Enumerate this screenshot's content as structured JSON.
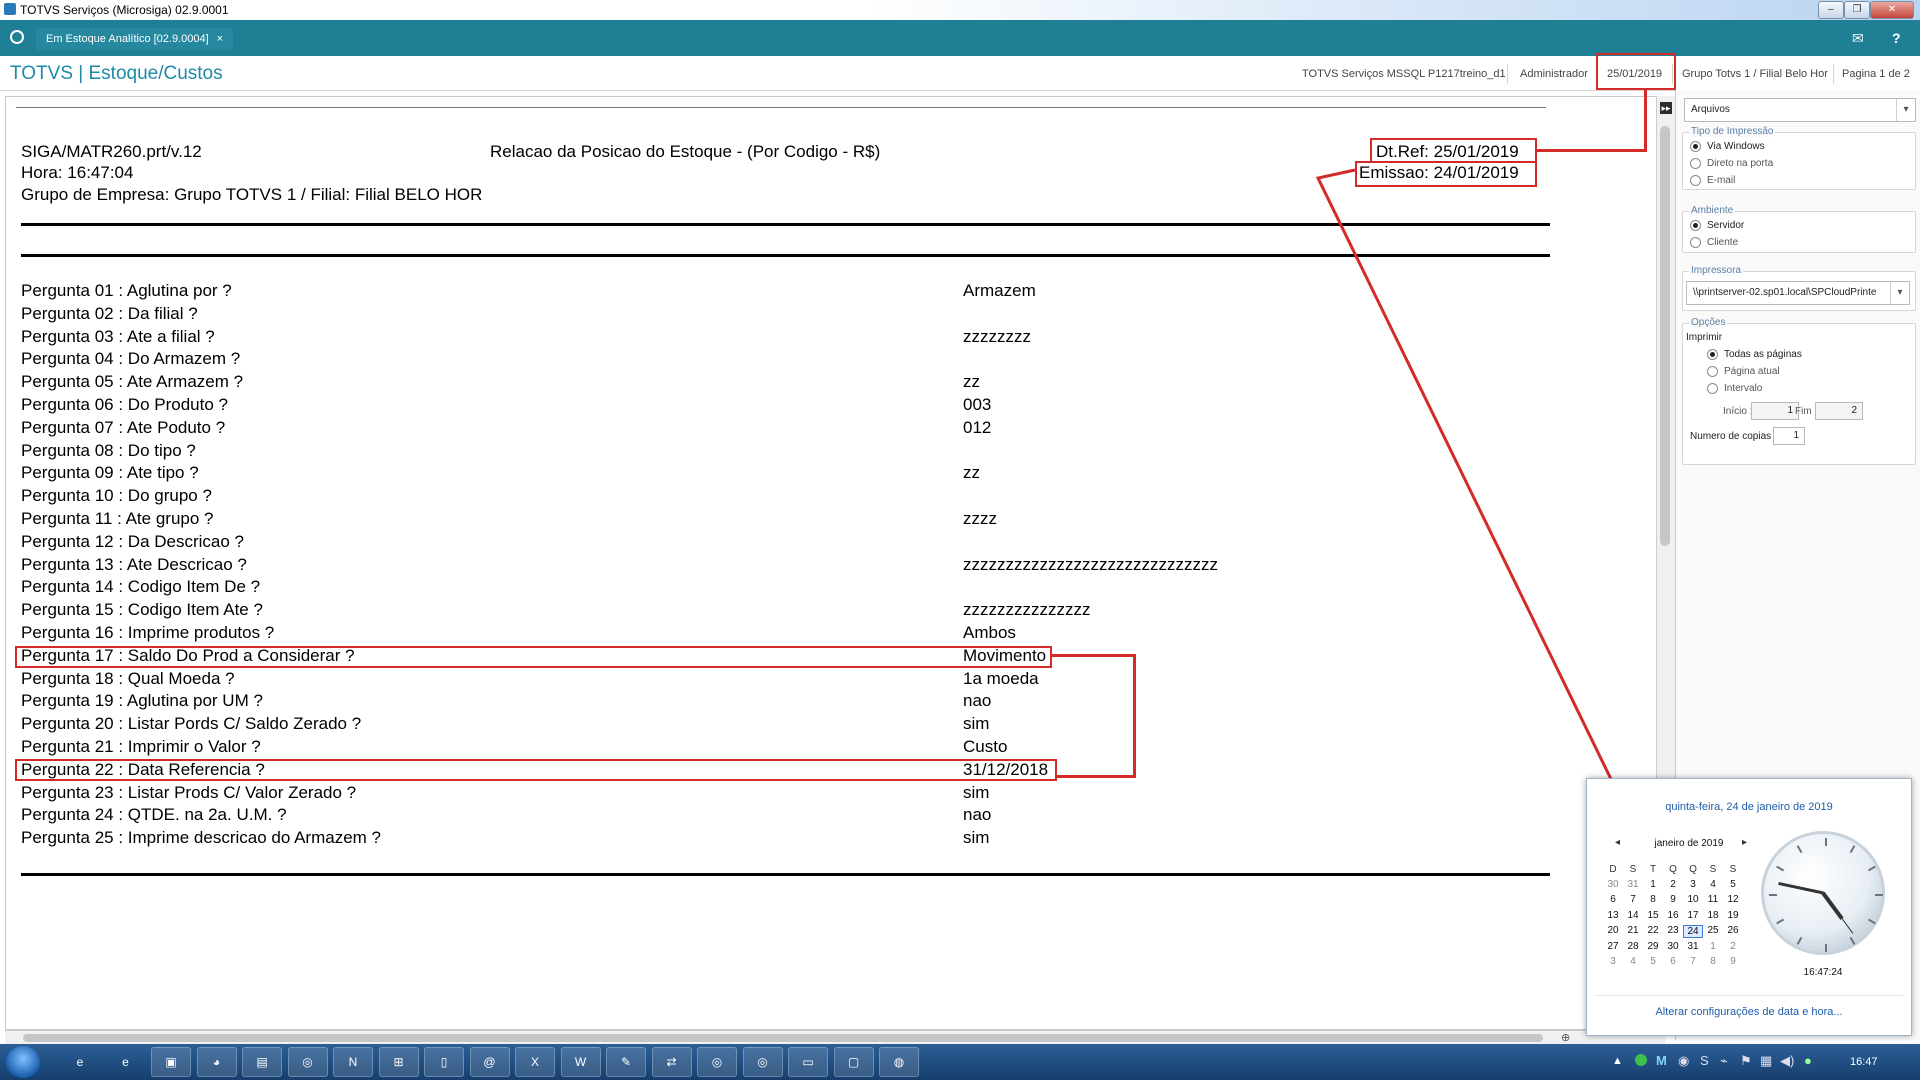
{
  "window": {
    "title": "TOTVS Serviços (Microsiga) 02.9.0001"
  },
  "tabs": [
    {
      "label": "Em Estoque Analítico [02.9.0004]",
      "close": "×"
    }
  ],
  "header": {
    "brand": "TOTVS | Estoque/Custos",
    "environment": "TOTVS Serviços MSSQL P1217treino_d1",
    "user": "Administrador",
    "date": "25/01/2019",
    "company": "Grupo Totvs 1 / Filial Belo Hor",
    "page": "Pagina 1 de 2"
  },
  "report": {
    "program": "SIGA/MATR260.prt/v.12",
    "title": "Relacao da Posicao do Estoque - (Por Codigo - R$)",
    "dt_ref": "Dt.Ref: 25/01/2019",
    "hora": "Hora: 16:47:04",
    "emissao": "Emissao: 24/01/2019",
    "grupo": "Grupo de Empresa: Grupo TOTVS 1 / Filial: Filial BELO HOR",
    "questions": [
      {
        "label": "Pergunta 01 : Aglutina por ?",
        "value": "Armazem"
      },
      {
        "label": "Pergunta 02 : Da filial ?",
        "value": ""
      },
      {
        "label": "Pergunta 03 : Ate a filial ?",
        "value": "zzzzzzzz"
      },
      {
        "label": "Pergunta 04 : Do Armazem ?",
        "value": ""
      },
      {
        "label": "Pergunta 05 : Ate Armazem ?",
        "value": "zz"
      },
      {
        "label": "Pergunta 06 : Do Produto ?",
        "value": "003"
      },
      {
        "label": "Pergunta 07 : Ate Poduto ?",
        "value": "012"
      },
      {
        "label": "Pergunta 08 : Do tipo ?",
        "value": ""
      },
      {
        "label": "Pergunta 09 : Ate tipo ?",
        "value": "zz"
      },
      {
        "label": "Pergunta 10 : Do grupo ?",
        "value": ""
      },
      {
        "label": "Pergunta 11 : Ate grupo ?",
        "value": "zzzz"
      },
      {
        "label": "Pergunta 12 : Da Descricao ?",
        "value": ""
      },
      {
        "label": "Pergunta 13 : Ate Descricao ?",
        "value": "zzzzzzzzzzzzzzzzzzzzzzzzzzzzzz"
      },
      {
        "label": "Pergunta 14 : Codigo Item De ?",
        "value": ""
      },
      {
        "label": "Pergunta 15 : Codigo Item Ate ?",
        "value": "zzzzzzzzzzzzzzz"
      },
      {
        "label": "Pergunta 16 : Imprime produtos ?",
        "value": "Ambos"
      },
      {
        "label": "Pergunta 17 : Saldo Do Prod a Considerar ?",
        "value": "Movimento"
      },
      {
        "label": "Pergunta 18 : Qual Moeda ?",
        "value": "1a moeda"
      },
      {
        "label": "Pergunta 19 : Aglutina por UM ?",
        "value": "nao"
      },
      {
        "label": "Pergunta 20 : Listar Pords C/ Saldo Zerado ?",
        "value": "sim"
      },
      {
        "label": "Pergunta 21 : Imprimir o Valor ?",
        "value": "Custo"
      },
      {
        "label": "Pergunta 22 : Data Referencia ?",
        "value": "31/12/2018"
      },
      {
        "label": "Pergunta 23 : Listar Prods C/ Valor Zerado ?",
        "value": "sim"
      },
      {
        "label": "Pergunta 24 : QTDE. na 2a. U.M. ?",
        "value": "nao"
      },
      {
        "label": "Pergunta 25 : Imprime descricao do Armazem ?",
        "value": "sim"
      }
    ]
  },
  "panel": {
    "destino": "Arquivos",
    "tipo_impressao": {
      "legend": "Tipo de Impressão",
      "options": [
        "Via Windows",
        "Direto na porta",
        "E-mail"
      ],
      "selected": "Via Windows"
    },
    "ambiente": {
      "legend": "Ambiente",
      "options": [
        "Servidor",
        "Cliente"
      ],
      "selected": "Servidor"
    },
    "impressora": {
      "legend": "Impressora",
      "value": "\\\\printserver-02.sp01.local\\SPCloudPrinte"
    },
    "opcoes": {
      "legend": "Opções",
      "imprimir": "Imprimir",
      "options": [
        "Todas as páginas",
        "Página atual",
        "Intervalo"
      ],
      "selected": "Todas as páginas",
      "inicio_label": "Início :",
      "inicio": "1",
      "fim_label": "Fim :",
      "fim": "2",
      "copias_label": "Numero de copias",
      "copias": "1"
    }
  },
  "calendar": {
    "full_date": "quinta-feira, 24 de janeiro de 2019",
    "month": "janeiro de 2019",
    "prev": "◂",
    "next": "▸",
    "dow": [
      "D",
      "S",
      "T",
      "Q",
      "Q",
      "S",
      "S"
    ],
    "weeks": [
      [
        "30",
        "31",
        "1",
        "2",
        "3",
        "4",
        "5"
      ],
      [
        "6",
        "7",
        "8",
        "9",
        "10",
        "11",
        "12"
      ],
      [
        "13",
        "14",
        "15",
        "16",
        "17",
        "18",
        "19"
      ],
      [
        "20",
        "21",
        "22",
        "23",
        "24",
        "25",
        "26"
      ],
      [
        "27",
        "28",
        "29",
        "30",
        "31",
        "1",
        "2"
      ],
      [
        "3",
        "4",
        "5",
        "6",
        "7",
        "8",
        "9"
      ]
    ],
    "selected_day": "24",
    "clock_time": "16:47:24",
    "link": "Alterar configurações de data e hora..."
  },
  "taskbar": {
    "apps": [
      "ie-icon",
      "ie-icon",
      "chat-icon",
      "firefox-icon",
      "folder-icon",
      "chrome-icon",
      "onenote-icon",
      "network-icon",
      "notepad-icon",
      "mail-icon",
      "excel-icon",
      "word-icon",
      "tools-icon",
      "connection-icon",
      "chrome-icon",
      "chrome-icon",
      "remote-icon",
      "window-icon",
      "totvs-icon"
    ],
    "clock": "16:47"
  }
}
